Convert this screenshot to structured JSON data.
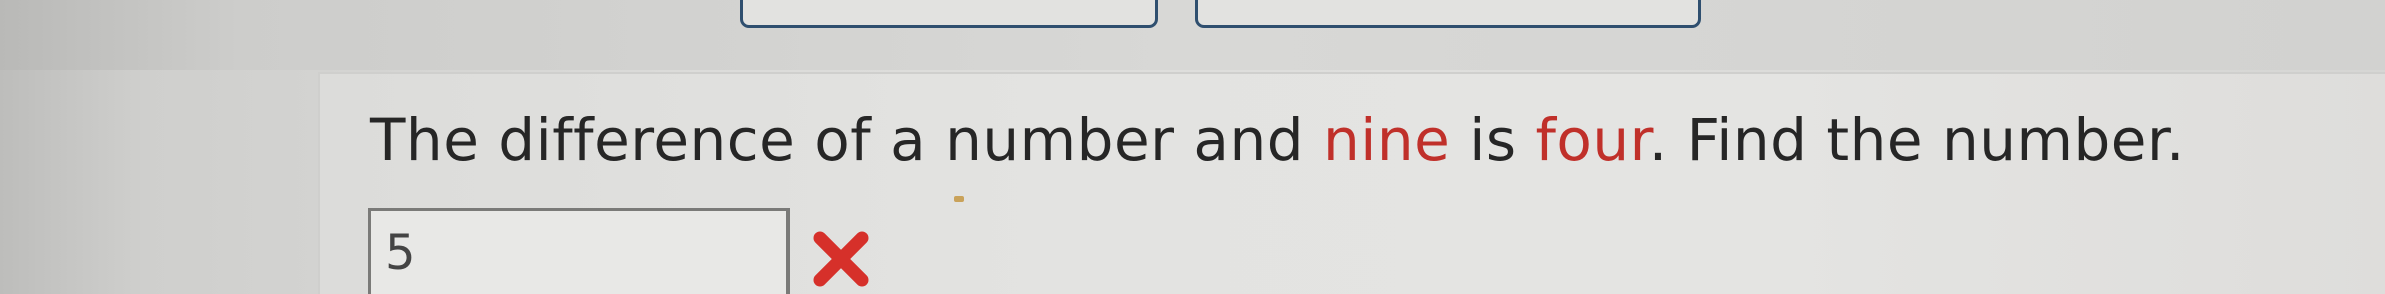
{
  "question": {
    "part1": "The difference of a number and ",
    "highlight1": "nine",
    "part2": " is ",
    "highlight2": "four",
    "part3": ". Find the number."
  },
  "answer": {
    "value": "5",
    "status": "incorrect"
  },
  "icons": {
    "feedback": "x-mark-icon"
  },
  "colors": {
    "highlight_text": "#c0302a",
    "incorrect_mark": "#d6302a",
    "top_button_border": "#2f4f6f"
  }
}
